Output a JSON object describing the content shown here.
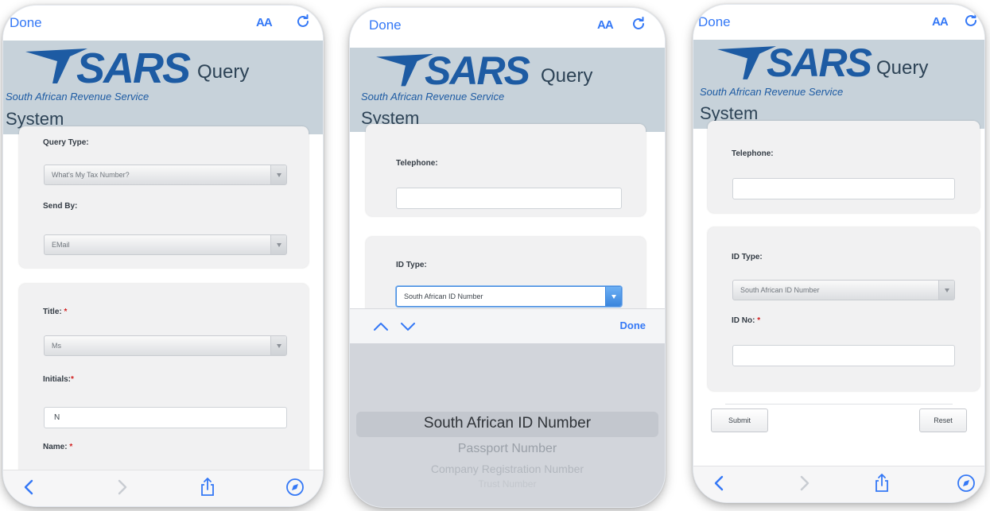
{
  "brand": {
    "sars": "SARS",
    "query": "Query",
    "subtitle": "South African Revenue Service",
    "system": "System"
  },
  "topbar": {
    "done": "Done",
    "text_size": "AA"
  },
  "phone1": {
    "query_type_label": "Query Type:",
    "query_type_value": "What's My Tax Number?",
    "send_by_label": "Send By:",
    "send_by_value": "EMail",
    "title_label": "Title:",
    "title_value": "Ms",
    "initials_label": "Initials:",
    "initials_value": "N",
    "name_label": "Name:",
    "required_mark": "*"
  },
  "phone2": {
    "telephone_label": "Telephone:",
    "id_type_label": "ID Type:",
    "id_type_value": "South African ID Number",
    "accessory_done": "Done",
    "picker_options": [
      "South African ID Number",
      "Passport Number",
      "Company Registration Number",
      "Trust Number"
    ],
    "picker_selected": "South African ID Number"
  },
  "phone3": {
    "telephone_label": "Telephone:",
    "id_type_label": "ID Type:",
    "id_type_value": "South African ID Number",
    "id_no_label": "ID No:",
    "required_mark": "*",
    "submit_label": "Submit",
    "reset_label": "Reset"
  },
  "icons": {
    "back": "chevron-left-icon",
    "forward": "chevron-right-icon",
    "share": "share-icon",
    "bookmarks": "compass-icon",
    "reload": "reload-icon",
    "picker_up": "chevron-up-icon",
    "picker_down": "chevron-down-icon",
    "sars_logo": "sars-logo-icon"
  },
  "colors": {
    "ios_blue": "#3478f6",
    "sars_blue": "#1d5ba3",
    "banner_bg": "#c7d2da",
    "required": "#d22020"
  }
}
